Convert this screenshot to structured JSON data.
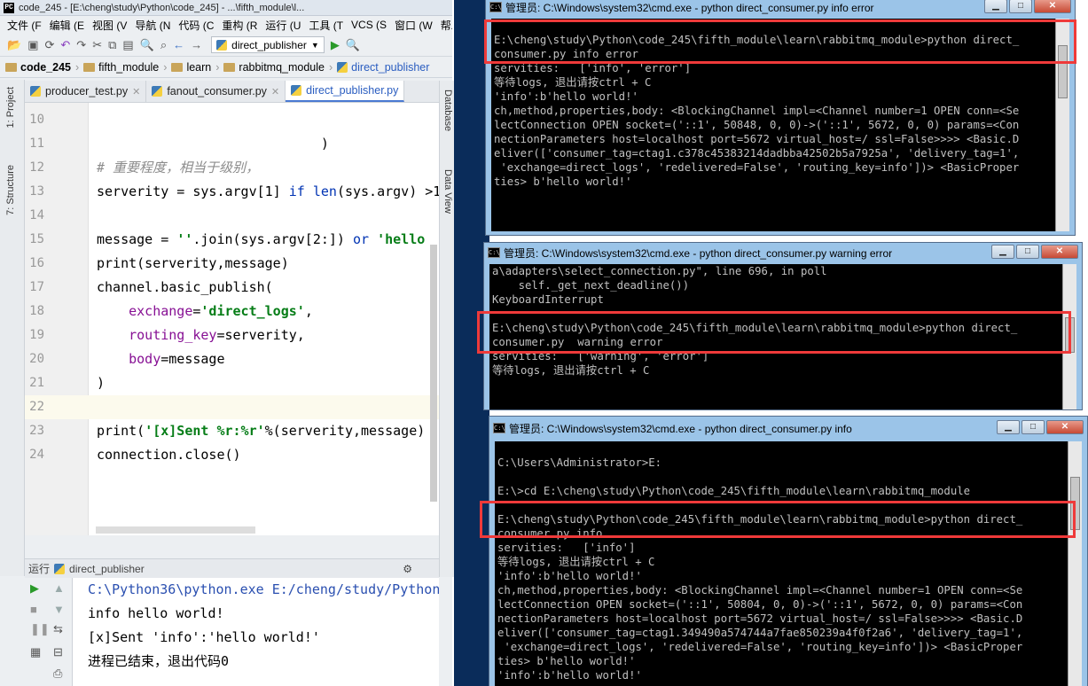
{
  "ide": {
    "title": "code_245 - [E:\\cheng\\study\\Python\\code_245] - ...\\fifth_module\\l...",
    "menu": [
      "文件 (F",
      "编辑 (E",
      "视图 (V",
      "导航 (N",
      "代码 (C",
      "重构 (R",
      "运行 (U",
      "工具 (T",
      "VCS (S",
      "窗口 (W",
      "帮助 (H"
    ],
    "run_config": "direct_publisher",
    "breadcrumbs": [
      "code_245",
      "fifth_module",
      "learn",
      "rabbitmq_module",
      "direct_publisher"
    ],
    "left_tabs": [
      "1: Project",
      "7: Structure"
    ],
    "right_tabs": [
      "Database",
      "Data View"
    ],
    "tabs": [
      {
        "label": "producer_test.py"
      },
      {
        "label": "fanout_consumer.py"
      },
      {
        "label": "direct_publisher.py"
      }
    ],
    "code_lines": [
      {
        "num": "10",
        "text": ""
      },
      {
        "num": "11",
        "text": "                            )"
      },
      {
        "num": "12",
        "text": "# 重要程度，相当于级别，"
      },
      {
        "num": "13",
        "text": "serverity = sys.argv[1] if len(sys.argv) >1"
      },
      {
        "num": "14",
        "text": ""
      },
      {
        "num": "15",
        "text": "message = ''.join(sys.argv[2:]) or 'hello"
      },
      {
        "num": "16",
        "text": "print(serverity,message)"
      },
      {
        "num": "17",
        "text": "channel.basic_publish("
      },
      {
        "num": "18",
        "text": "    exchange='direct_logs',"
      },
      {
        "num": "19",
        "text": "    routing_key=serverity,"
      },
      {
        "num": "20",
        "text": "    body=message"
      },
      {
        "num": "21",
        "text": ")"
      },
      {
        "num": "22",
        "text": ""
      },
      {
        "num": "23",
        "text": "print('[x]Sent %r:%r'%(serverity,message)"
      },
      {
        "num": "24",
        "text": "connection.close()"
      }
    ],
    "run_label": "运行",
    "run_name": "direct_publisher",
    "run_output": [
      "C:\\Python36\\python.exe E:/cheng/study/Python",
      "info hello world!",
      "[x]Sent 'info':'hello world!'",
      "",
      "进程已结束，退出代码0"
    ]
  },
  "cmd_windows": [
    {
      "title": "管理员: C:\\Windows\\system32\\cmd.exe - python  direct_consumer.py info error",
      "lines": [
        "",
        "E:\\cheng\\study\\Python\\code_245\\fifth_module\\learn\\rabbitmq_module>python direct_",
        "consumer.py info error",
        "servities:   ['info', 'error']",
        "等待logs, 退出请按ctrl + C",
        "'info':b'hello world!'",
        "ch,method,properties,body: <BlockingChannel impl=<Channel number=1 OPEN conn=<Se",
        "lectConnection OPEN socket=('::1', 50848, 0, 0)->('::1', 5672, 0, 0) params=<Con",
        "nectionParameters host=localhost port=5672 virtual_host=/ ssl=False>>>> <Basic.D",
        "eliver(['consumer_tag=ctag1.c378c45383214dadbba42502b5a7925a', 'delivery_tag=1',",
        " 'exchange=direct_logs', 'redelivered=False', 'routing_key=info'])> <BasicProper",
        "ties> b'hello world!'"
      ]
    },
    {
      "title": "管理员: C:\\Windows\\system32\\cmd.exe - python  direct_consumer.py  warning error",
      "lines": [
        "a\\adapters\\select_connection.py\", line 696, in poll",
        "    self._get_next_deadline())",
        "KeyboardInterrupt",
        "",
        "E:\\cheng\\study\\Python\\code_245\\fifth_module\\learn\\rabbitmq_module>python direct_",
        "consumer.py  warning error",
        "servities:   ['warning', 'error']",
        "等待logs, 退出请按ctrl + C"
      ]
    },
    {
      "title": "管理员: C:\\Windows\\system32\\cmd.exe - python  direct_consumer.py info",
      "lines": [
        "",
        "C:\\Users\\Administrator>E:",
        "",
        "E:\\>cd E:\\cheng\\study\\Python\\code_245\\fifth_module\\learn\\rabbitmq_module",
        "",
        "E:\\cheng\\study\\Python\\code_245\\fifth_module\\learn\\rabbitmq_module>python direct_",
        "consumer.py info",
        "servities:   ['info']",
        "等待logs, 退出请按ctrl + C",
        "'info':b'hello world!'",
        "ch,method,properties,body: <BlockingChannel impl=<Channel number=1 OPEN conn=<Se",
        "lectConnection OPEN socket=('::1', 50804, 0, 0)->('::1', 5672, 0, 0) params=<Con",
        "nectionParameters host=localhost port=5672 virtual_host=/ ssl=False>>>> <Basic.D",
        "eliver(['consumer_tag=ctag1.349490a574744a7fae850239a4f0f2a6', 'delivery_tag=1',",
        " 'exchange=direct_logs', 'redelivered=False', 'routing_key=info'])> <BasicProper",
        "ties> b'hello world!'",
        "'info':b'hello world!'"
      ]
    }
  ],
  "window_buttons": {
    "minimize": "▁",
    "maximize": "□",
    "close": "✕"
  },
  "colors": {
    "highlight": "#ef3a3a",
    "cmd_bg": "#000000",
    "cmd_text": "#c0c0c0",
    "string": "#067d17",
    "keyword": "#0033b3",
    "param": "#871094"
  }
}
